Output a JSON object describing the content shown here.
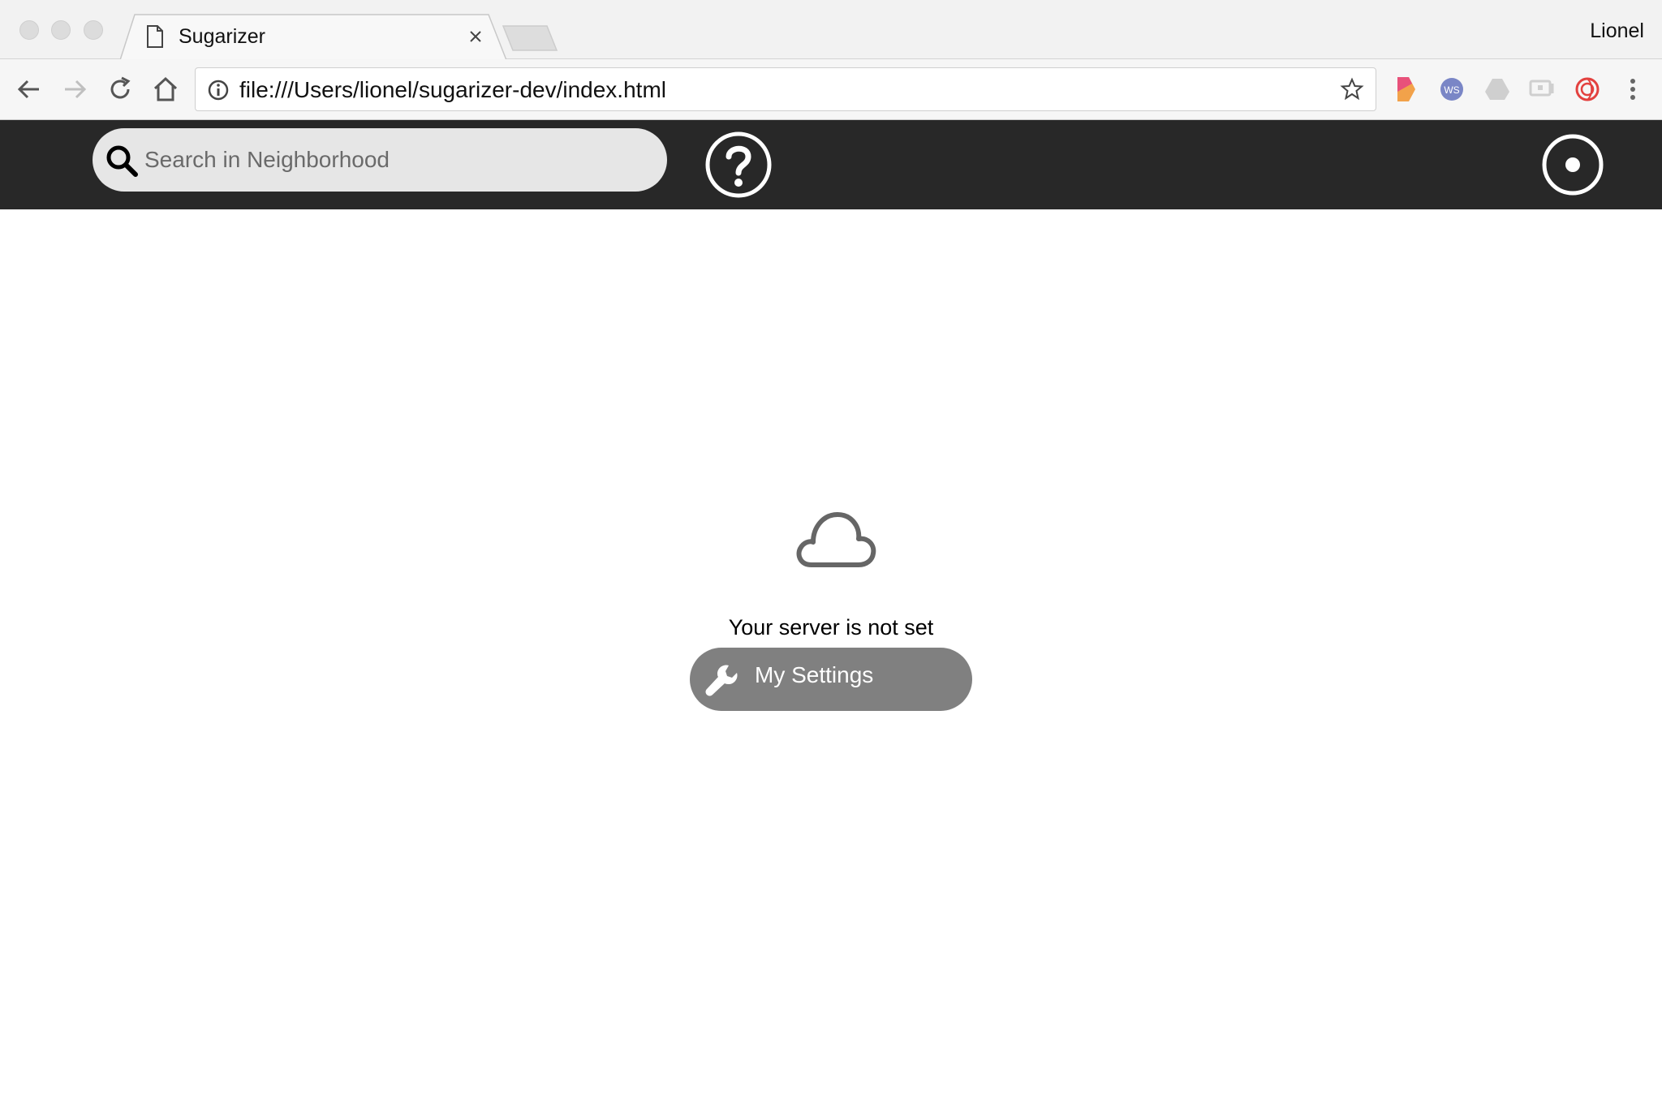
{
  "browser": {
    "tab": {
      "title": "Sugarizer"
    },
    "profile_name": "Lionel",
    "address_bar": {
      "url": "file:///Users/lionel/sugarizer-dev/index.html"
    },
    "extensions": [
      "bookmark-ext-icon",
      "wikisource-ext-icon",
      "drive-ext-icon",
      "cast-ext-icon",
      "swirl-ext-icon"
    ]
  },
  "sugar_toolbar": {
    "search": {
      "placeholder": "Search in Neighborhood"
    }
  },
  "main": {
    "message": "Your server is not set",
    "settings_button": {
      "label": "My Settings"
    }
  },
  "colors": {
    "toolbar_bg": "#282828",
    "search_bg": "#e6e6e6",
    "button_bg": "#808080"
  }
}
